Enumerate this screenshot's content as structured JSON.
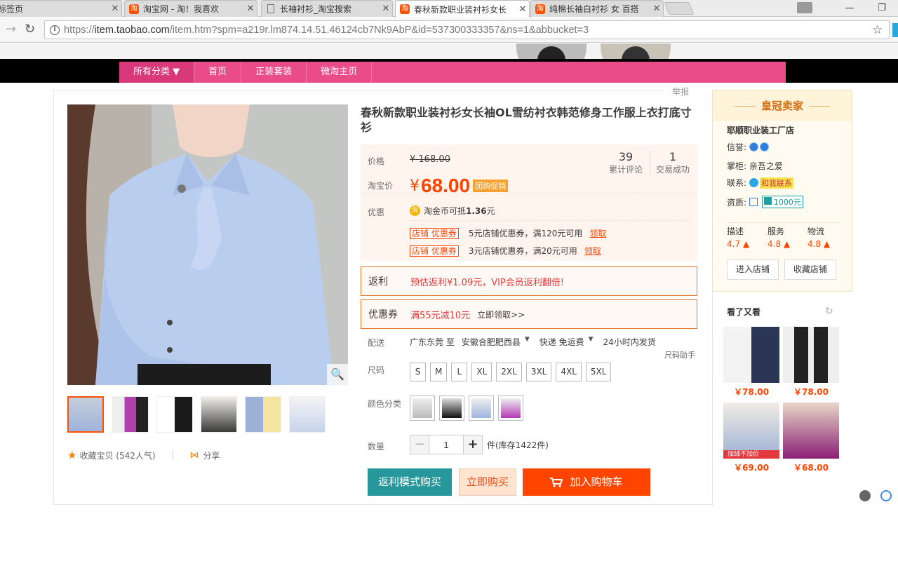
{
  "browser": {
    "tabs": [
      {
        "label": "标签页",
        "favicon": "none",
        "active": false
      },
      {
        "label": "淘宝网 - 淘！我喜欢",
        "favicon": "taobao-icon",
        "active": false
      },
      {
        "label": "长袖衬衫_淘宝搜索",
        "favicon": "document-icon",
        "active": false
      },
      {
        "label": "春秋新款职业装衬衫女长",
        "favicon": "taobao-icon",
        "active": true
      },
      {
        "label": "纯棉长袖白衬衫 女 百搭",
        "favicon": "taobao-icon",
        "active": false
      }
    ],
    "url_prefix": "https://",
    "url_host": "item.taobao.com",
    "url_path": "/item.htm?spm=a219r.lm874.14.51.46124cb7Nk9AbP&id=537300333357&ns=1&abbucket=3"
  },
  "shop_nav": {
    "items": [
      "所有分类",
      "首页",
      "正装套装",
      "微淘主页"
    ]
  },
  "report_label": "举报",
  "product": {
    "title": "春秋新款职业装衬衫女长袖OL雪纺衬衣韩范修身工作服上衣打底寸衫",
    "price_label": "价格",
    "original_price": "¥ 168.00",
    "promo_label": "淘宝价",
    "promo_currency": "¥",
    "promo_price": "68.00",
    "promo_tag": "团购促销",
    "reviews_count": "39",
    "reviews_label": "累计评论",
    "deals_count": "1",
    "deals_label": "交易成功",
    "discount_label": "优惠",
    "coin_text": "淘金币可抵",
    "coin_value": "1.36",
    "coin_unit": "元",
    "coupons": [
      {
        "tag": "店铺 优惠券",
        "text": "5元店铺优惠券，满120元可用",
        "claim": "领取"
      },
      {
        "tag": "店铺 优惠券",
        "text": "3元店铺优惠券，满20元可用",
        "claim": "领取"
      }
    ],
    "rebate": {
      "label": "返利",
      "text": "预估返利¥1.09元，VIP会员返利翻倍!"
    },
    "voucher": {
      "label": "优惠券",
      "text": "满55元减10元",
      "link": "立即领取>>"
    },
    "delivery_label": "配送",
    "delivery": {
      "from": "广东东莞 至",
      "to": "安徽合肥肥西县",
      "method": "快递 免运费",
      "ship_time": "24小时内发货"
    },
    "size_helper": "尺码助手",
    "size_label": "尺码",
    "sizes": [
      "S",
      "M",
      "L",
      "XL",
      "2XL",
      "3XL",
      "4XL",
      "5XL"
    ],
    "color_label": "颜色分类",
    "quantity_label": "数量",
    "quantity": "1",
    "stock_text": "件(库存1422件)",
    "buttons": {
      "rebate_buy": "返利模式购买",
      "buy_now": "立即购买",
      "add_cart": "加入购物车"
    },
    "favorite_text": "收藏宝贝 (542人气)",
    "share_text": "分享"
  },
  "seller": {
    "rank_title": "皇冠卖家",
    "shop_name": "耶顺职业装工厂店",
    "credit_label": "信誉:",
    "keeper_label": "掌柜:",
    "keeper_name": "亲吾之爱",
    "contact_label": "联系:",
    "contact_button": "和我联系",
    "qualify_label": "资质:",
    "deposit": "1000元",
    "dsr": [
      {
        "label": "描述",
        "score": "4.7"
      },
      {
        "label": "服务",
        "score": "4.8"
      },
      {
        "label": "物流",
        "score": "4.8"
      }
    ],
    "enter_shop": "进入店铺",
    "fav_shop": "收藏店铺"
  },
  "recommend": {
    "title": "看了又看",
    "items": [
      {
        "price": "￥78.00"
      },
      {
        "price": "￥78.00"
      },
      {
        "price": "￥69.00",
        "badge": "加绒不加价"
      },
      {
        "price": "￥68.00"
      }
    ]
  },
  "colors": {
    "accent": "#ff4400",
    "shop_nav": "#ea4c89",
    "rebate_btn": "#26979a"
  }
}
